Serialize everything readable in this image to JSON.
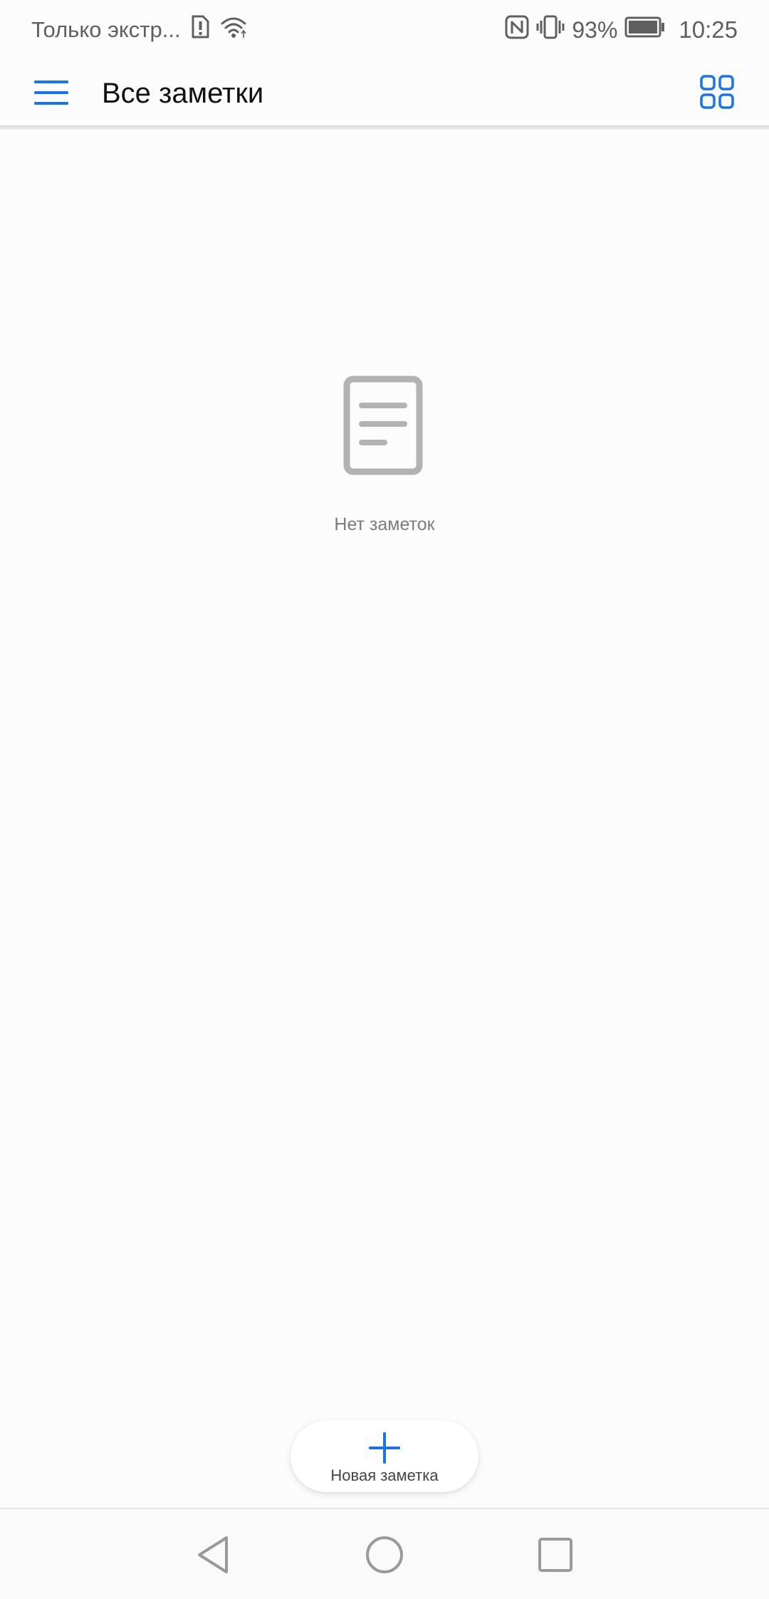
{
  "status_bar": {
    "carrier_text": "Только экстр...",
    "battery_percent": "93%",
    "time": "10:25",
    "icons": [
      "sim-alert-icon",
      "wifi-icon",
      "nfc-icon",
      "vibrate-icon",
      "battery-icon"
    ]
  },
  "app_bar": {
    "title": "Все заметки",
    "menu_icon": "hamburger-menu-icon",
    "view_toggle_icon": "grid-view-icon"
  },
  "empty_state": {
    "icon": "note-document-icon",
    "message": "Нет заметок"
  },
  "fab": {
    "icon": "plus-icon",
    "label": "Новая заметка"
  },
  "nav_bar": {
    "buttons": [
      "back-icon",
      "home-icon",
      "recent-apps-icon"
    ]
  },
  "colors": {
    "accent": "#1a73e8",
    "background": "#fcfcfc",
    "icon_grey": "#b2b2b2",
    "text_primary": "#111111",
    "text_secondary": "#7c7c7c"
  }
}
